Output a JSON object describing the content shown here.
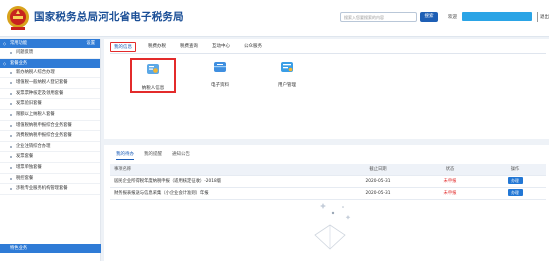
{
  "header": {
    "title": "国家税务总局河北省电子税务局",
    "search_placeholder": "搜索入您要搜索的内容",
    "search_button": "搜索",
    "welcome": "欢迎",
    "exit": "退出"
  },
  "sidebar": {
    "top_label": "常用功能",
    "top_action": "设置",
    "items_a": [
      "问题反馈"
    ],
    "section": "套餐业务",
    "items_b": [
      "新办纳税人综合办理",
      "增值税一般纳税人登记套餐",
      "发票票种核定及领用套餐",
      "发票验旧套餐",
      "限额以上纳税人套餐",
      "增值税纳税申报综合业务套餐",
      "消费税纳税申报综合业务套餐",
      "企业注销综合办理",
      "发票套餐",
      "增票单独套餐",
      "税控套餐",
      "涉税专业服务机构管理套餐"
    ],
    "bottom": "特色业务"
  },
  "top_tabs": [
    "我的信息",
    "税费办税",
    "税费查询",
    "互动中心",
    "公众服务"
  ],
  "functions": [
    {
      "label": "纳税人信息"
    },
    {
      "label": "电子资料"
    },
    {
      "label": "用户管理"
    }
  ],
  "bottom_tabs": [
    "我的待办",
    "我的提醒",
    "通知公告"
  ],
  "table": {
    "headers": [
      "事项名称",
      "截止日期",
      "状态",
      "操作"
    ],
    "rows": [
      {
        "name": "居民企业所得税年度纳税申报（适用核定征收）-2018版",
        "deadline": "2020-05-31",
        "status": "未申报",
        "action": "办理"
      },
      {
        "name": "财务报表报送与信息采集（小企业会计准则）年报",
        "deadline": "2020-05-31",
        "status": "未申报",
        "action": "办理"
      }
    ]
  },
  "colors": {
    "primary": "#1e5fb5",
    "highlight": "#e32b2b",
    "sidebar_head": "#2f7bd6"
  }
}
